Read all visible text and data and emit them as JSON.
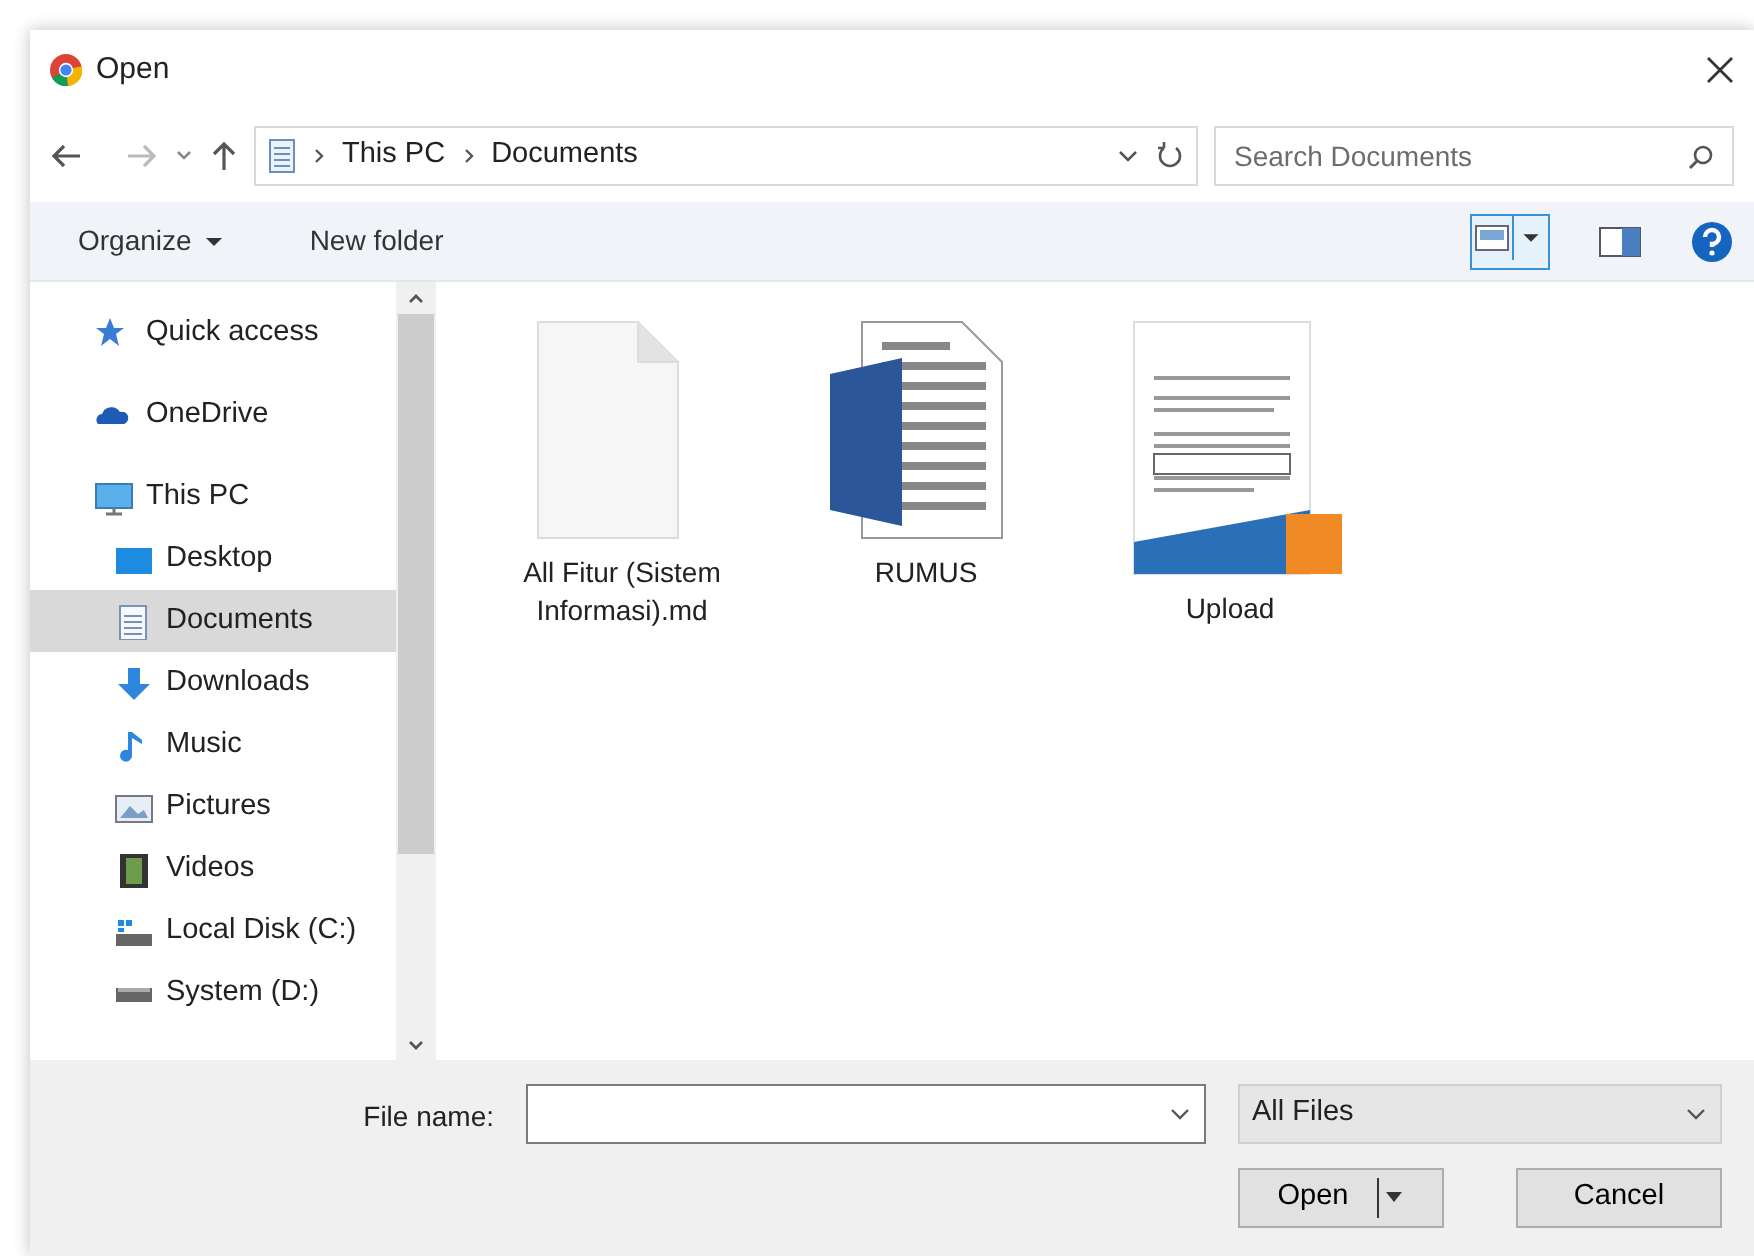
{
  "window": {
    "title": "Open"
  },
  "address_bar": {
    "path": [
      {
        "label": "This PC"
      },
      {
        "label": "Documents"
      }
    ]
  },
  "search": {
    "placeholder": "Search Documents"
  },
  "toolbar": {
    "buttons": [
      "Organize",
      "New folder"
    ]
  },
  "sidebar": {
    "items": [
      {
        "label": "Quick access",
        "kind": "star",
        "selected": false
      },
      {
        "label": "OneDrive",
        "kind": "cloud",
        "selected": false
      },
      {
        "label": "This PC",
        "kind": "computer",
        "selected": false,
        "children": [
          {
            "label": "Desktop",
            "kind": "desktop",
            "selected": false
          },
          {
            "label": "Documents",
            "kind": "documents",
            "selected": true
          },
          {
            "label": "Downloads",
            "kind": "downloads",
            "selected": false
          },
          {
            "label": "Music",
            "kind": "music",
            "selected": false
          },
          {
            "label": "Pictures",
            "kind": "pictures",
            "selected": false
          },
          {
            "label": "Videos",
            "kind": "videos",
            "selected": false
          },
          {
            "label": "Local Disk (C:)",
            "kind": "disk",
            "selected": false
          },
          {
            "label": "System (D:)",
            "kind": "drive",
            "selected": false
          }
        ]
      }
    ]
  },
  "files": [
    {
      "name": "All Fitur (Sistem Informasi).md",
      "kind": "blank"
    },
    {
      "name": "RUMUS",
      "kind": "word"
    },
    {
      "name": "Upload",
      "kind": "pdf"
    }
  ],
  "footer": {
    "file_name_label": "File name:",
    "file_type": "All Files",
    "buttons": [
      "Open",
      "Cancel"
    ]
  }
}
